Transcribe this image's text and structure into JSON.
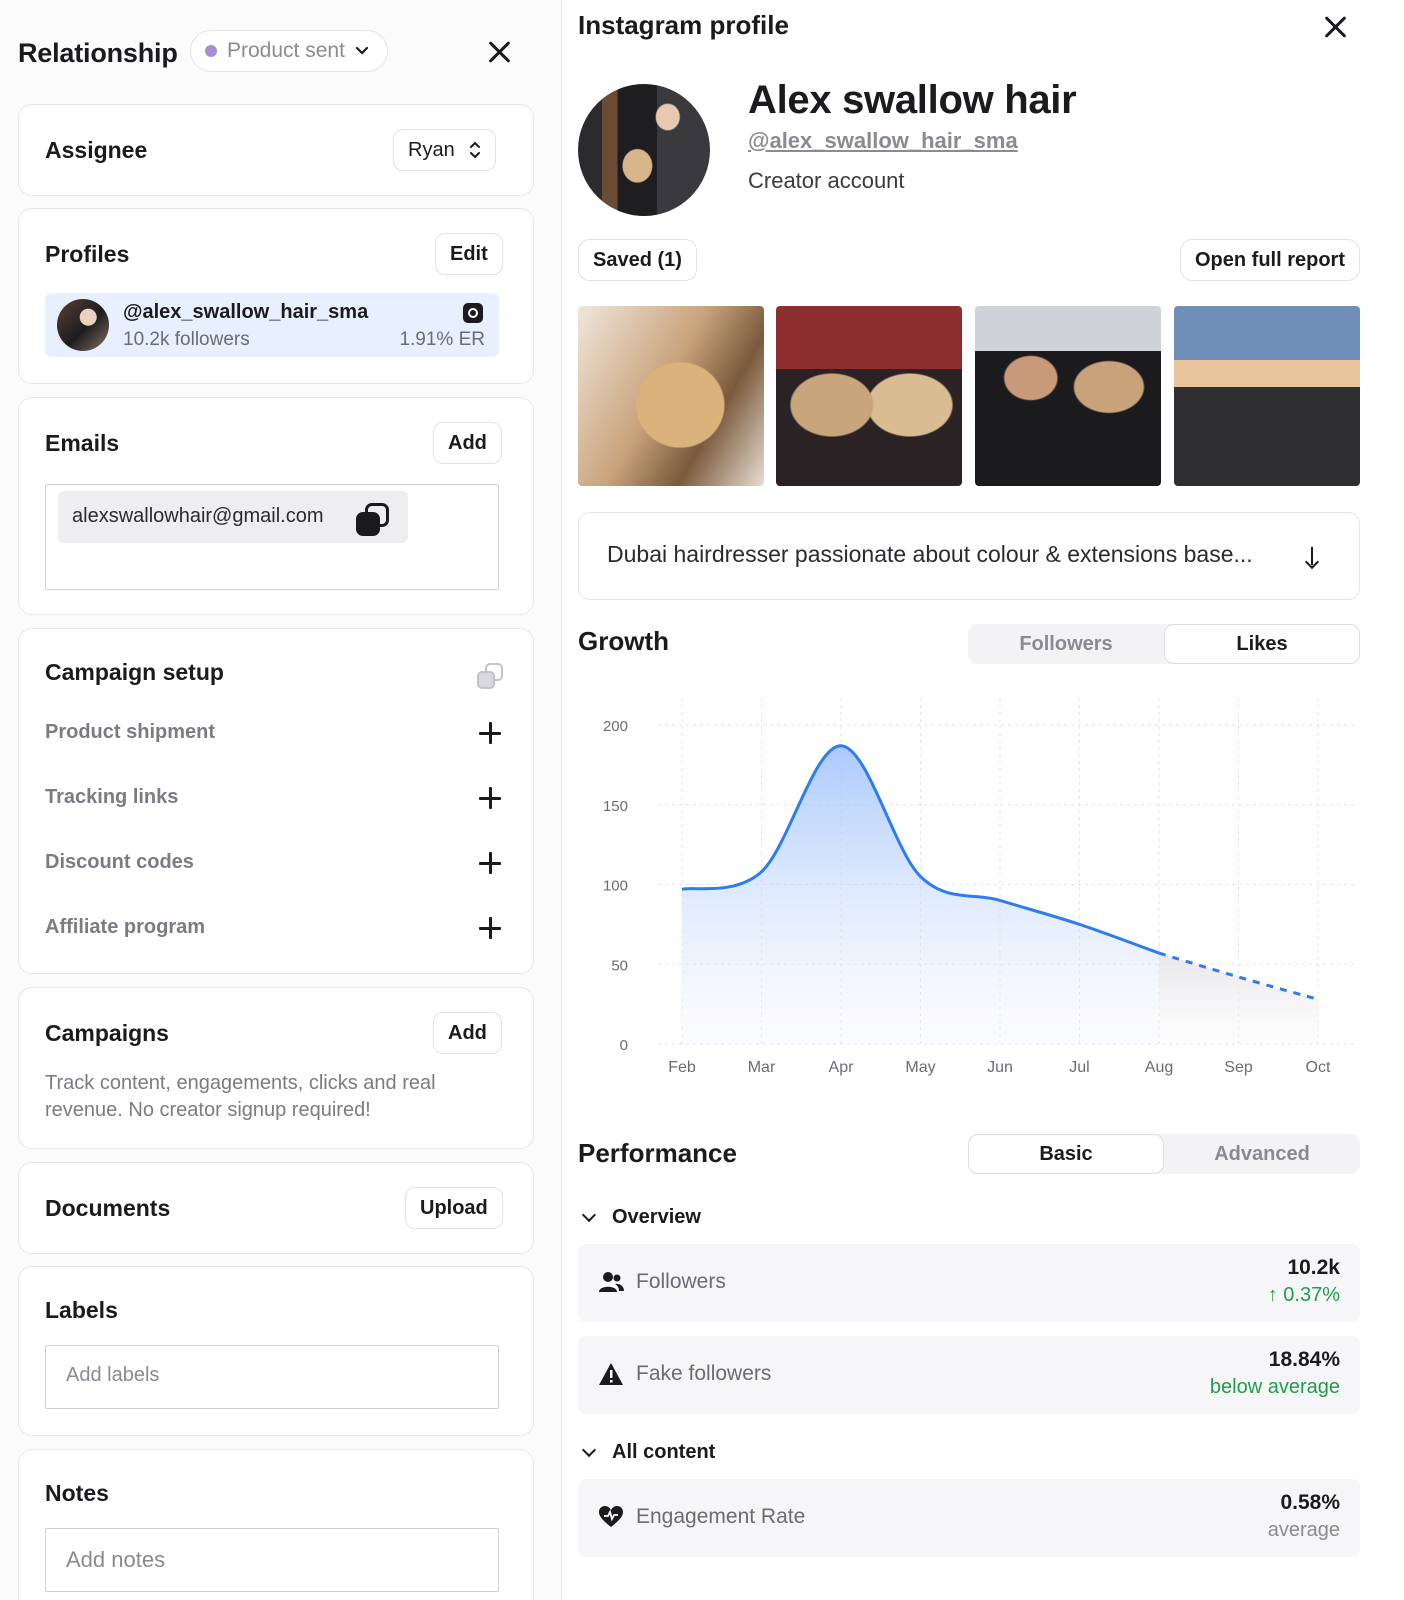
{
  "left": {
    "title": "Relationship",
    "status": "Product sent",
    "assignee": {
      "title": "Assignee",
      "value": "Ryan"
    },
    "profiles": {
      "title": "Profiles",
      "edit_label": "Edit",
      "handle": "@alex_swallow_hair_sma",
      "followers": "10.2k followers",
      "er": "1.91% ER"
    },
    "emails": {
      "title": "Emails",
      "add_label": "Add",
      "email": "alexswallowhair@gmail.com"
    },
    "campaign_setup": {
      "title": "Campaign setup",
      "items": [
        "Product shipment",
        "Tracking links",
        "Discount codes",
        "Affiliate program"
      ]
    },
    "campaigns": {
      "title": "Campaigns",
      "add_label": "Add",
      "description": "Track content, engagements, clicks and real revenue. No creator signup required!"
    },
    "documents": {
      "title": "Documents",
      "upload_label": "Upload"
    },
    "labels": {
      "title": "Labels",
      "placeholder": "Add labels"
    },
    "notes": {
      "title": "Notes",
      "placeholder": "Add notes"
    }
  },
  "right": {
    "title": "Instagram profile",
    "profile": {
      "name": "Alex swallow hair",
      "handle": "@alex_swallow_hair_sma",
      "type": "Creator account"
    },
    "saved_label": "Saved (1)",
    "report_label": "Open full report",
    "bio": "Dubai hairdresser passionate about colour & extensions base...",
    "growth": {
      "title": "Growth",
      "tabs": [
        "Followers",
        "Likes"
      ],
      "active_tab": "Likes"
    },
    "performance": {
      "title": "Performance",
      "tabs": [
        "Basic",
        "Advanced"
      ],
      "active_tab": "Basic",
      "overview_label": "Overview",
      "all_content_label": "All content",
      "metrics": [
        {
          "label": "Followers",
          "value": "10.2k",
          "sub": "↑ 0.37%",
          "sub_color": "#1f9d4c",
          "icon": "users-icon"
        },
        {
          "label": "Fake followers",
          "value": "18.84%",
          "sub": "below average",
          "sub_color": "#1f9d4c",
          "icon": "warning-icon"
        },
        {
          "label": "Engagement Rate",
          "value": "0.58%",
          "sub": "average",
          "sub_color": "#8a8a93",
          "icon": "heart-icon"
        }
      ]
    }
  },
  "chart_data": {
    "type": "area",
    "x": [
      "Feb",
      "Mar",
      "Apr",
      "May",
      "Jun",
      "Jul",
      "Aug",
      "Sep",
      "Oct"
    ],
    "series": [
      {
        "values": [
          97,
          108,
          187,
          105,
          90,
          75,
          57,
          42,
          28
        ]
      }
    ],
    "projected_from_index": 6,
    "yticks": [
      0,
      50,
      100,
      150,
      200
    ],
    "ylim": [
      0,
      200
    ],
    "grid": true,
    "line_color": "#2f7bf0"
  }
}
